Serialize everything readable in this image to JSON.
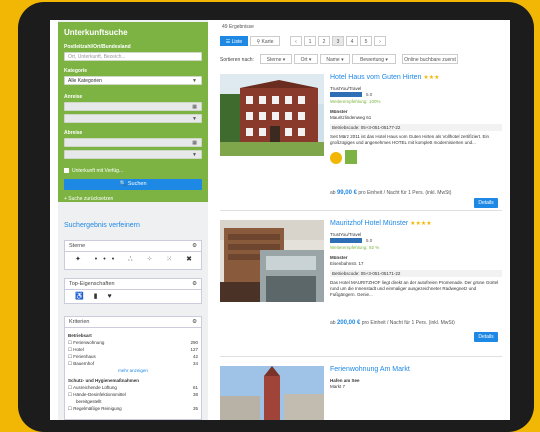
{
  "search": {
    "title": "Unterkunftsuche",
    "loc_label": "Postleitzahl/Ort/Bundesland",
    "loc_placeholder": "Ort, Unterkunft, Bezeich...",
    "cat_label": "Kategorie",
    "cat_value": "Alle Kategorien",
    "arr_label": "Anreise",
    "dep_label": "Abreise",
    "check_label": "Unterkunft mit Verfüg...",
    "submit": "Suchen",
    "advanced": "+ Suche zurücksetzen"
  },
  "refine": {
    "title": "Suchergebnis verfeinern",
    "sterne_label": "Sterne",
    "top_label": "Top-Eigenschaften",
    "kriterien_label": "Kriterien",
    "group1": "Betriebsart",
    "items1": [
      {
        "label": "Ferienwohnung",
        "count": "290"
      },
      {
        "label": "Hotel",
        "count": "127"
      },
      {
        "label": "Ferienhaus",
        "count": "42"
      },
      {
        "label": "Bauernhof",
        "count": "34"
      }
    ],
    "more": "mehr anzeigen",
    "group2": "Schutz- und Hygienemaßnahmen",
    "items2": [
      {
        "label": "Ausreichende Lüftung",
        "count": "61"
      },
      {
        "label": "Hände-Desinfektionsmittel",
        "count": "38"
      },
      {
        "label": "bereitgestellt",
        "count": ""
      },
      {
        "label": "Regelmäßige Reinigung",
        "count": "35"
      }
    ]
  },
  "results": {
    "count_text": "49 Ergebnisse",
    "view_list": "Liste",
    "view_map": "Karte",
    "pages": [
      "‹",
      "1",
      "2",
      "3",
      "4",
      "5",
      "›"
    ],
    "sort_label": "Sortieren nach:",
    "sort": [
      "Sterne",
      "Ort",
      "Name",
      "Bewertung"
    ],
    "only_avail": "Online buchbare zuerst"
  },
  "cards": [
    {
      "name": "Hotel Haus vom Guten Hirten",
      "stars": "★★★",
      "tc_label": "TrustYou/Travel",
      "score": "5.0",
      "recommend": "Weiterempfehlung: 100%",
      "city": "Münster",
      "street": "Mauritzlindenweg 61",
      "reg": "Betriebscode: 05+3-051-05177-22",
      "desc": "Seit März 2011 ist das Hotel Haus vom Guten Hirten als Vollhotel zertifiziert. Ein großzügiges und angenehmes HOTEL mit komplett modernisierten und...",
      "price_prefix": "ab",
      "price": "99,00 €",
      "price_suffix": "pro Einheit / Nacht für 1 Pers. (inkl. MwSt)",
      "details": "Details"
    },
    {
      "name": "Mauritzhof Hotel Münster",
      "stars": "★★★★",
      "tc_label": "TrustYou/Travel",
      "score": "5.0",
      "recommend": "Weiterempfehlung: 92 %",
      "city": "Münster",
      "street": "Eisenbahnstr. 17",
      "reg": "Betriebscode: 05+3-051-05171-22",
      "desc": "Das Hotel MAURITZHOF liegt direkt an der autofreien Promenade. Der grüne Gürtel rund um die Innenstadt und einmaliger ausgezeichneter Radwegnetz und Fußgängern. Genie...",
      "price_prefix": "ab",
      "price": "200,00 €",
      "price_suffix": "pro Einheit / Nacht für 1 Pers. (inkl. MwSt)",
      "details": "Details"
    },
    {
      "name": "Ferienwohnung Am Markt",
      "line2": "Hafen am See",
      "line3": "Markt 7"
    }
  ]
}
